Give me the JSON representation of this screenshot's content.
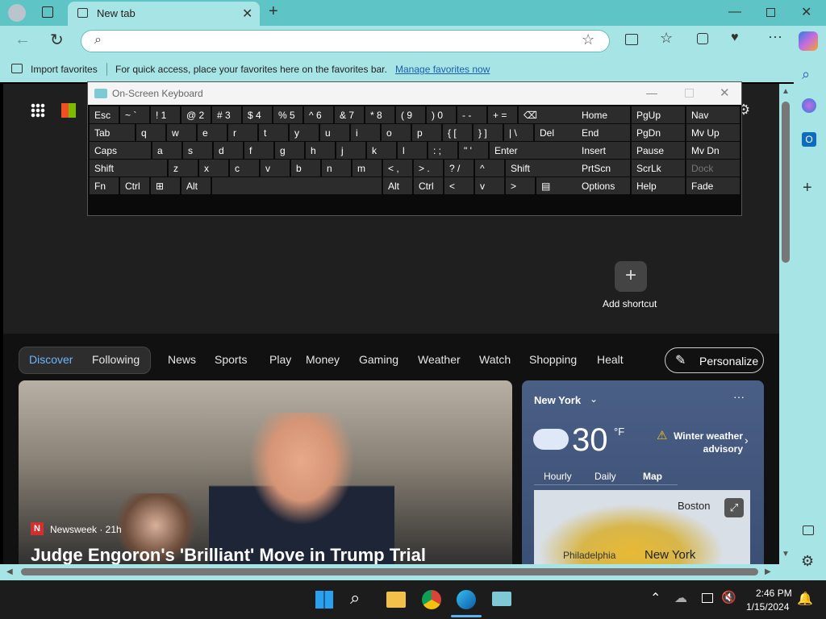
{
  "browser": {
    "tab_title": "New tab",
    "address_placeholder": "",
    "favbar_import": "Import favorites",
    "favbar_text": "For quick access, place your favorites here on the favorites bar.",
    "favbar_link": "Manage favorites now"
  },
  "osk": {
    "title": "On-Screen Keyboard",
    "rows": [
      [
        "Esc",
        "~ `",
        "! 1",
        "@ 2",
        "# 3",
        "$ 4",
        "% 5",
        "^ 6",
        "& 7",
        "* 8",
        "( 9",
        ") 0",
        "- -",
        "+ =",
        "⌫"
      ],
      [
        "Tab",
        "q",
        "w",
        "e",
        "r",
        "t",
        "y",
        "u",
        "i",
        "o",
        "p",
        "{ [",
        "} ]",
        "| \\",
        "Del"
      ],
      [
        "Caps",
        "a",
        "s",
        "d",
        "f",
        "g",
        "h",
        "j",
        "k",
        "l",
        ": ;",
        "\" '",
        "Enter"
      ],
      [
        "Shift",
        "z",
        "x",
        "c",
        "v",
        "b",
        "n",
        "m",
        "< ,",
        "> .",
        "? /",
        "^",
        "Shift"
      ],
      [
        "Fn",
        "Ctrl",
        "⊞",
        "Alt",
        "",
        "Alt",
        "Ctrl",
        "<",
        "v",
        ">",
        "▤"
      ]
    ],
    "nav1": [
      "Home",
      "End",
      "Insert",
      "PrtScn",
      "Options"
    ],
    "nav2": [
      "PgUp",
      "PgDn",
      "Pause",
      "ScrLk",
      "Help"
    ],
    "nav3": [
      "Nav",
      "Mv Up",
      "Mv Dn",
      "Dock",
      "Fade"
    ]
  },
  "newtab": {
    "add_shortcut": "Add shortcut",
    "feed_tabs": [
      "Discover",
      "Following",
      "News",
      "Sports",
      "Play",
      "Money",
      "Gaming",
      "Weather",
      "Watch",
      "Shopping",
      "Healt"
    ],
    "personalize": "Personalize",
    "news": {
      "source": "Newsweek · 21h",
      "headline": "Judge Engoron's 'Brilliant' Move in Trump Trial"
    },
    "weather": {
      "city": "New York",
      "temp": "30",
      "unit": "°F",
      "alert": "Winter weather advisory",
      "tabs": [
        "Hourly",
        "Daily",
        "Map"
      ],
      "map_labels": [
        "Boston",
        "Philadelphia",
        "New York"
      ]
    }
  },
  "taskbar": {
    "time": "2:46 PM",
    "date": "1/15/2024"
  }
}
